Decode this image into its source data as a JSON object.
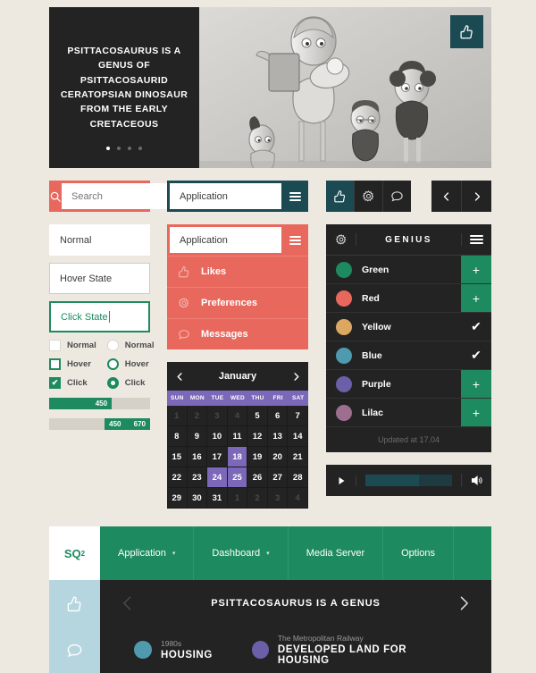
{
  "theme": {
    "background": "#EDE9E1",
    "dark": "#232323",
    "coral": "#E8685D",
    "green": "#1E8A5F",
    "teal": "#1C4A52",
    "purple": "#7B68B8",
    "lightblue": "#B6D6DF"
  },
  "hero": {
    "title": "PSITTACOSAURUS IS A GENUS OF PSITTACOSAURID CERATOPSIAN DINOSAUR FROM THE EARLY CRETACEOUS",
    "dots": 4,
    "active_dot": 0,
    "like_icon": "thumbs-up-icon"
  },
  "search": {
    "icon": "search-icon",
    "value": "Search",
    "placeholder": "Search"
  },
  "dropdown_closed": {
    "label": "Application",
    "menu_icon": "hamburger-icon"
  },
  "dropdown_open": {
    "label": "Application",
    "menu_icon": "hamburger-icon",
    "items": [
      {
        "label": "Likes",
        "icon": "thumbs-up-icon"
      },
      {
        "label": "Preferences",
        "icon": "gear-icon"
      },
      {
        "label": "Messages",
        "icon": "chat-bubble-icon"
      }
    ]
  },
  "icon_group": [
    {
      "name": "thumbs-up-icon",
      "active": true
    },
    {
      "name": "gear-icon",
      "active": false
    },
    {
      "name": "chat-bubble-icon",
      "active": false
    }
  ],
  "arrows": {
    "prev": "chevron-left-icon",
    "next": "chevron-right-icon"
  },
  "text_fields": [
    {
      "state": "normal",
      "value": "Normal"
    },
    {
      "state": "hover",
      "value": "Hover State"
    },
    {
      "state": "click",
      "value": "Click State"
    }
  ],
  "checkboxes": [
    {
      "label": "Normal",
      "state": "normal"
    },
    {
      "label": "Hover",
      "state": "hover"
    },
    {
      "label": "Click",
      "state": "click",
      "mark": "✔"
    }
  ],
  "radios": [
    {
      "label": "Normal",
      "state": "normal"
    },
    {
      "label": "Hover",
      "state": "hover"
    },
    {
      "label": "Click",
      "state": "click"
    }
  ],
  "progress_bars": [
    {
      "style": "single",
      "value": "450",
      "fill_percent": 62,
      "offset_percent": 0
    },
    {
      "style": "range",
      "min_value": "450",
      "max_value": "670",
      "fill_percent": 45,
      "offset_percent": 55
    }
  ],
  "genius": {
    "title": "GENIUS",
    "gear_icon": "gear-icon",
    "menu_icon": "hamburger-icon",
    "footer": "Updated at 17.04",
    "rows": [
      {
        "label": "Green",
        "color": "#1E8A5F",
        "action": "add",
        "action_glyph": "+"
      },
      {
        "label": "Red",
        "color": "#E8685D",
        "action": "add",
        "action_glyph": "+"
      },
      {
        "label": "Yellow",
        "color": "#DCA861",
        "action": "check",
        "action_glyph": "✔"
      },
      {
        "label": "Blue",
        "color": "#4F9AAF",
        "action": "check",
        "action_glyph": "✔"
      },
      {
        "label": "Purple",
        "color": "#6B5FA8",
        "action": "add",
        "action_glyph": "+"
      },
      {
        "label": "Lilac",
        "color": "#9E6E8E",
        "action": "add",
        "action_glyph": "+"
      }
    ]
  },
  "calendar": {
    "month": "January",
    "prev_icon": "chevron-left-icon",
    "next_icon": "chevron-right-icon",
    "weekdays": [
      "SUN",
      "MON",
      "TUE",
      "WED",
      "THU",
      "FRI",
      "SAT"
    ],
    "days": [
      {
        "n": "1",
        "muted": true
      },
      {
        "n": "2",
        "muted": true
      },
      {
        "n": "3",
        "muted": true
      },
      {
        "n": "4",
        "muted": true
      },
      {
        "n": "5"
      },
      {
        "n": "6"
      },
      {
        "n": "7"
      },
      {
        "n": "8"
      },
      {
        "n": "9"
      },
      {
        "n": "10"
      },
      {
        "n": "11"
      },
      {
        "n": "12"
      },
      {
        "n": "13"
      },
      {
        "n": "14"
      },
      {
        "n": "15"
      },
      {
        "n": "16"
      },
      {
        "n": "17"
      },
      {
        "n": "18",
        "selected": true
      },
      {
        "n": "19"
      },
      {
        "n": "20"
      },
      {
        "n": "21"
      },
      {
        "n": "22"
      },
      {
        "n": "23"
      },
      {
        "n": "24",
        "selected": true
      },
      {
        "n": "25",
        "selected": true
      },
      {
        "n": "26"
      },
      {
        "n": "27"
      },
      {
        "n": "28"
      },
      {
        "n": "29"
      },
      {
        "n": "30"
      },
      {
        "n": "31"
      },
      {
        "n": "1",
        "muted": true
      },
      {
        "n": "2",
        "muted": true
      },
      {
        "n": "3",
        "muted": true
      },
      {
        "n": "4",
        "muted": true
      }
    ]
  },
  "media_player": {
    "play_icon": "play-icon",
    "volume_icon": "volume-icon",
    "progress_percent": 62
  },
  "navbar": {
    "logo": "SQ",
    "logo_sup": "2",
    "items": [
      {
        "label": "Application",
        "has_caret": true
      },
      {
        "label": "Dashboard",
        "has_caret": true
      },
      {
        "label": "Media Server",
        "has_caret": false
      },
      {
        "label": "Options",
        "has_caret": false
      }
    ]
  },
  "carousel": {
    "side_icon": "thumbs-up-icon",
    "prev_icon": "chevron-left-icon",
    "next_icon": "chevron-right-icon",
    "title": "PSITTACOSAURUS IS A GENUS"
  },
  "bottom_list": {
    "side_icon": "chat-bubble-icon",
    "items": [
      {
        "sub": "1980s",
        "title": "HOUSING",
        "color": "#4F9AAF"
      },
      {
        "sub": "The Metropolitan Railway",
        "title": "DEVELOPED LAND FOR HOUSING",
        "color": "#6B5FA8"
      }
    ]
  }
}
